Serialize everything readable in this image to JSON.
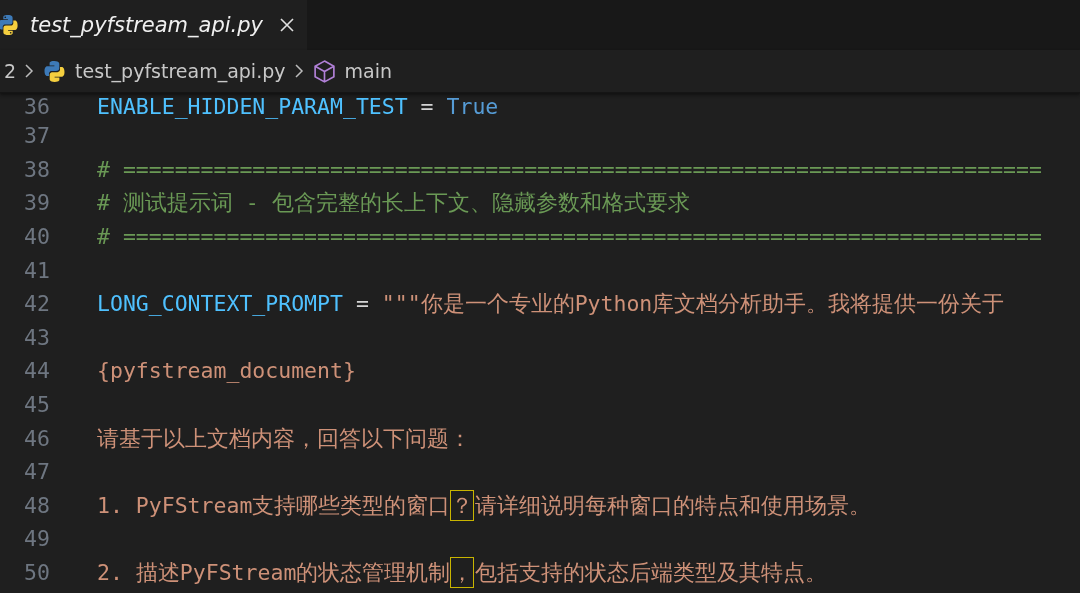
{
  "tabs": [
    {
      "label": "test_pyfstream_api.py",
      "selected": true,
      "italic": true
    }
  ],
  "breadcrumbs": [
    {
      "kind": "folder",
      "label": "2"
    },
    {
      "kind": "file",
      "label": "test_pyfstream_api.py"
    },
    {
      "kind": "symbol",
      "label": "main"
    }
  ],
  "lines": [
    {
      "number": "36",
      "segments": [
        {
          "kind": "variable",
          "text": "ENABLE_HIDDEN_PARAM_TEST"
        },
        {
          "kind": "operator",
          "text": " = "
        },
        {
          "kind": "constant",
          "text": "True"
        }
      ]
    },
    {
      "number": "37"
    },
    {
      "number": "38",
      "segments": [
        {
          "kind": "comment",
          "text": "# ======================================================================="
        }
      ]
    },
    {
      "number": "39",
      "segments": [
        {
          "kind": "comment",
          "text": "# 测试提示词 - 包含完整的长上下文、隐藏参数和格式要求"
        }
      ]
    },
    {
      "number": "40",
      "segments": [
        {
          "kind": "comment",
          "text": "# ======================================================================="
        }
      ]
    },
    {
      "number": "41"
    },
    {
      "number": "42",
      "segments": [
        {
          "kind": "variable",
          "text": "LONG_CONTEXT_PROMPT"
        },
        {
          "kind": "operator",
          "text": " = "
        },
        {
          "kind": "string",
          "text": "\"\"\"你是一个专业的Python库文档分析助手。我将提供一份关于"
        }
      ]
    },
    {
      "number": "43"
    },
    {
      "number": "44",
      "segments": [
        {
          "kind": "string",
          "text": "{pyfstream_document}"
        }
      ]
    },
    {
      "number": "45"
    },
    {
      "number": "46",
      "segments": [
        {
          "kind": "string",
          "text": "请基于以上文档内容，回答以下问题："
        }
      ]
    },
    {
      "number": "47"
    },
    {
      "number": "48",
      "segments": [
        {
          "kind": "string",
          "text": "1. PyFStream支持哪些类型的窗口"
        },
        {
          "kind": "string",
          "text": "？",
          "highlight": true
        },
        {
          "kind": "string",
          "text": "请详细说明每种窗口的特点和使用场景。"
        }
      ]
    },
    {
      "number": "49"
    },
    {
      "number": "50",
      "segments": [
        {
          "kind": "string",
          "text": "2. 描述PyFStream的状态管理机制"
        },
        {
          "kind": "string",
          "text": "，",
          "highlight": true
        },
        {
          "kind": "string",
          "text": "包括支持的状态后端类型及其特点。"
        }
      ]
    }
  ]
}
